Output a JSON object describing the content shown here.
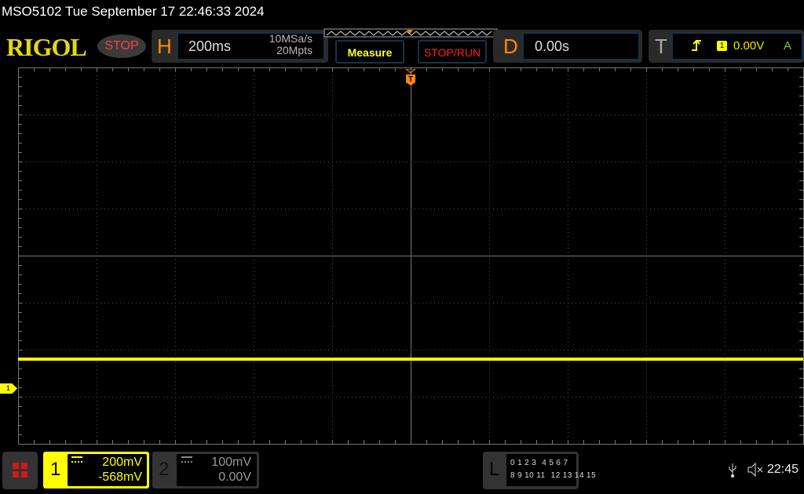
{
  "title": "MSO5102  Tue September 17 22:46:33 2024",
  "logo": "RIGOL",
  "run_state": "STOP",
  "horizontal": {
    "letter": "H",
    "scale": "200ms",
    "sample_rate": "10MSa/s",
    "memory_depth": "20Mpts"
  },
  "buttons": {
    "measure": "Measure",
    "stop_run": "STOP/RUN"
  },
  "delay": {
    "letter": "D",
    "value": "0.00s"
  },
  "trigger": {
    "letter": "T",
    "edge_icon": "rising-edge-icon",
    "source": "1",
    "level": "0.00V",
    "mode": "A"
  },
  "trigger_marker": "T",
  "grid": {
    "h_divisions": 10,
    "v_divisions": 8
  },
  "trace": {
    "color": "#ffff00",
    "level_div": -2.2
  },
  "channels": [
    {
      "number": "1",
      "scale": "200mV",
      "offset": "-568mV",
      "coupling_icon": "dc-coupling-icon",
      "color": "#ffff00",
      "active": true
    },
    {
      "number": "2",
      "scale": "100mV",
      "offset": "0.00V",
      "coupling_icon": "dc-coupling-icon",
      "color": "#888888",
      "active": false
    }
  ],
  "ch1_marker": "1",
  "logic": {
    "letter": "L",
    "row1": [
      "0",
      "1",
      "2",
      "3",
      "4",
      "5",
      "6",
      "7"
    ],
    "row2": [
      "8",
      "9",
      "10",
      "11",
      "12",
      "13",
      "14",
      "15"
    ]
  },
  "status": {
    "usb_icon": "usb-icon",
    "mute_icon": "speaker-muted-icon",
    "time": "22:45"
  },
  "colors": {
    "accent_orange": "#ff8a00",
    "stop_red": "#ff4040",
    "channel1": "#ffff00",
    "trigger_auto": "#6cd12b"
  }
}
